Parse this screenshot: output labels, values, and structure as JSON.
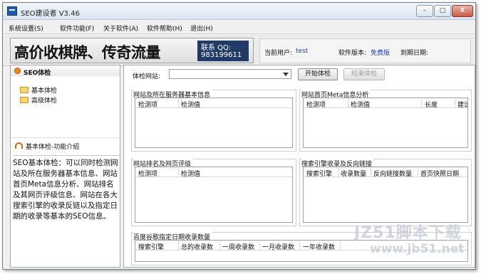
{
  "window": {
    "title": "SEO建设者 V3.46"
  },
  "window_buttons": {
    "min": "–",
    "max": "▢",
    "close": "X"
  },
  "menu": [
    "系统设置(S)",
    "软件功能(F)",
    "关于软件(A)",
    "软件帮助(H)",
    "退出(H)"
  ],
  "banner": {
    "main": "高价收棋牌、传奇流量",
    "qq_label": "联系 QQ:",
    "qq": "983199611"
  },
  "user_info": {
    "user_label": "当前用户:",
    "user": "test",
    "version_label": "软件版本:",
    "version": "免费版",
    "expire_label": "到期日期:"
  },
  "left": {
    "header": "SEO体检",
    "tree": [
      "基本体检",
      "高级体检"
    ],
    "intro_title": "基本体检-功能介绍",
    "intro_text": "SEO基本体检：可以同时检测网站及所在服务器基本信息、网站首页Meta信息分析、网站排名及其网页评级信息、网站在各大搜索引擎的收录反链以及指定日期的收录等基本的SEO信息。"
  },
  "main": {
    "site_label": "体检网站:",
    "site_value": "",
    "start_button": "开始体检",
    "end_button": "结束体检",
    "groups": {
      "server": {
        "title": "网站及所在服务器基本信息",
        "cols": [
          "检测项",
          "检测值"
        ]
      },
      "meta": {
        "title": "网站首页Meta信息分析",
        "cols": [
          "检测项",
          "检测值",
          "长度",
          "建议"
        ]
      },
      "rank": {
        "title": "网站排名及网页评级",
        "cols": [
          "检测项",
          "检测值"
        ]
      },
      "index": {
        "title": "搜索引擎收录及反向链接",
        "cols": [
          "搜索引擎",
          "收录数量",
          "反向链接数量",
          "首页快照日期"
        ]
      },
      "baidu": {
        "title": "百度谷歌指定日期收录数量",
        "cols": [
          "搜索引擎",
          "总的收录数",
          "一周收录数",
          "一月收录数",
          "一年收录数"
        ]
      }
    }
  },
  "watermark": {
    "text": "JZ51脚本下载",
    "url": "www.jb51.net"
  }
}
